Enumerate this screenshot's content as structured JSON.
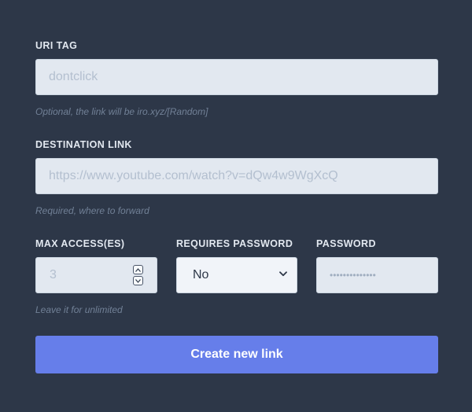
{
  "uri_tag": {
    "label": "URI TAG",
    "placeholder": "dontclick",
    "help": "Optional, the link will be iro.xyz/[Random]"
  },
  "destination": {
    "label": "DESTINATION LINK",
    "placeholder": "https://www.youtube.com/watch?v=dQw4w9WgXcQ",
    "help": "Required, where to forward"
  },
  "max_access": {
    "label": "MAX ACCESS(ES)",
    "placeholder": "3",
    "help": "Leave it for unlimited"
  },
  "requires_password": {
    "label": "REQUIRES PASSWORD",
    "value": "No"
  },
  "password": {
    "label": "PASSWORD",
    "placeholder": "••••••••••••••"
  },
  "submit_label": "Create new link"
}
